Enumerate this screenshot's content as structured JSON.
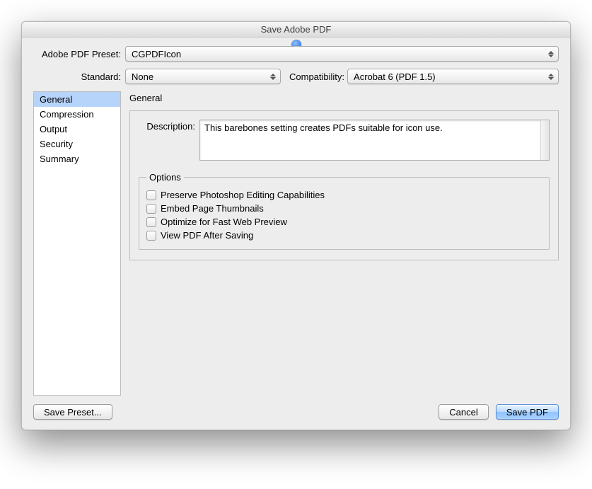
{
  "window": {
    "title": "Save Adobe PDF"
  },
  "preset": {
    "label": "Adobe PDF Preset:",
    "value": "CGPDFIcon"
  },
  "standard": {
    "label": "Standard:",
    "value": "None"
  },
  "compat": {
    "label": "Compatibility:",
    "value": "Acrobat 6 (PDF 1.5)"
  },
  "sidebar": {
    "items": [
      {
        "label": "General",
        "selected": true
      },
      {
        "label": "Compression",
        "selected": false
      },
      {
        "label": "Output",
        "selected": false
      },
      {
        "label": "Security",
        "selected": false
      },
      {
        "label": "Summary",
        "selected": false
      }
    ]
  },
  "panel": {
    "title": "General",
    "description_label": "Description:",
    "description_value": "This barebones setting creates PDFs suitable for icon use.",
    "options_legend": "Options",
    "options": [
      {
        "label": "Preserve Photoshop Editing Capabilities",
        "checked": false
      },
      {
        "label": "Embed Page Thumbnails",
        "checked": false
      },
      {
        "label": "Optimize for Fast Web Preview",
        "checked": false
      },
      {
        "label": "View PDF After Saving",
        "checked": false
      }
    ]
  },
  "footer": {
    "save_preset": "Save Preset...",
    "cancel": "Cancel",
    "save_pdf": "Save PDF"
  }
}
